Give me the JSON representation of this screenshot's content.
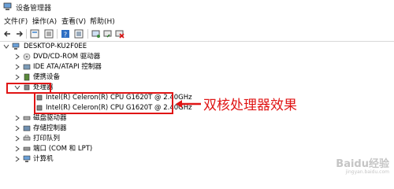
{
  "window": {
    "title": "设备管理器"
  },
  "menu": [
    "文件(F)",
    "操作(A)",
    "查看(V)",
    "帮助(H)"
  ],
  "toolbar_icons": [
    "back-icon",
    "forward-icon",
    "properties-icon",
    "list-icon",
    "help-icon",
    "details-icon",
    "scan-icon",
    "update-driver-icon",
    "uninstall-icon"
  ],
  "tree": {
    "root": "DESKTOP-KU2F0EE",
    "nodes": [
      {
        "label": "DVD/CD-ROM 驱动器",
        "icon": "dvd-icon"
      },
      {
        "label": "IDE ATA/ATAPI 控制器",
        "icon": "ide-icon"
      },
      {
        "label": "便携设备",
        "icon": "portable-device-icon"
      },
      {
        "label": "处理器",
        "icon": "processor-icon",
        "expanded": true,
        "children": [
          "Intel(R) Celeron(R) CPU G1620T @ 2.40GHz",
          "Intel(R) Celeron(R) CPU G1620T @ 2.40GHz"
        ]
      },
      {
        "label": "磁盘驱动器",
        "icon": "disk-icon"
      },
      {
        "label": "存储控制器",
        "icon": "storage-icon"
      },
      {
        "label": "打印队列",
        "icon": "printer-icon"
      },
      {
        "label": "端口 (COM 和 LPT)",
        "icon": "port-icon"
      },
      {
        "label": "计算机",
        "icon": "computer-icon"
      }
    ]
  },
  "annotation": {
    "text": "双核处理器效果",
    "color": "#e01515"
  },
  "watermark": {
    "text": "Baidu经验",
    "sub": "jingyan.baidu.com"
  }
}
